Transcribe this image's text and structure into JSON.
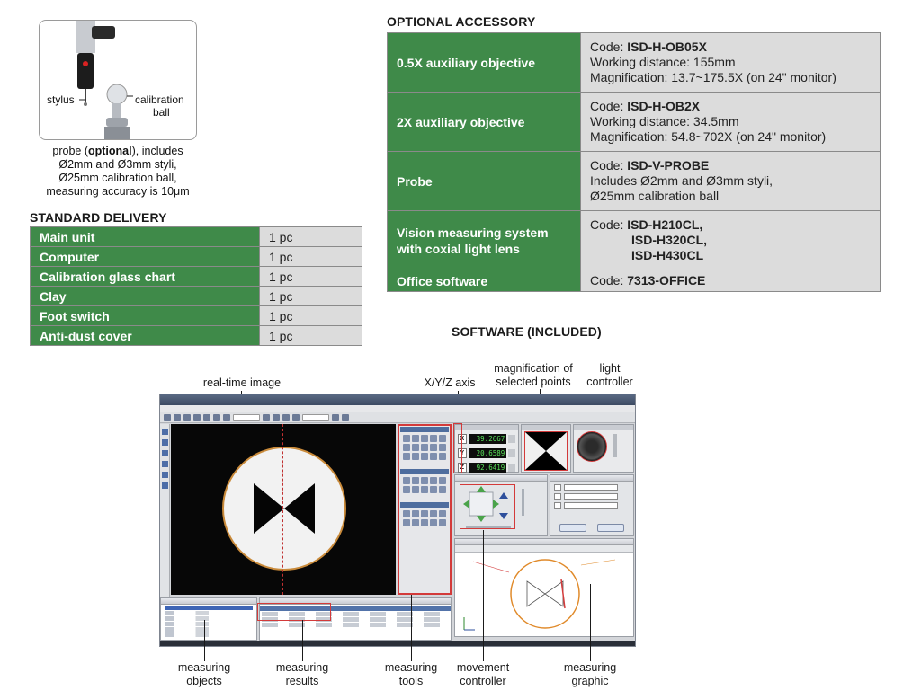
{
  "probe": {
    "stylus_label": "stylus",
    "calibration_label_1": "calibration",
    "calibration_label_2": "ball",
    "caption_1_a": "probe (",
    "caption_1_b": "optional",
    "caption_1_c": "), includes",
    "caption_2": "Ø2mm and Ø3mm styli,",
    "caption_3": "Ø25mm calibration ball,",
    "caption_4": "measuring accuracy is 10μm"
  },
  "standard_delivery": {
    "heading": "STANDARD DELIVERY",
    "rows": [
      {
        "item": "Main unit",
        "qty": "1 pc"
      },
      {
        "item": "Computer",
        "qty": "1 pc"
      },
      {
        "item": "Calibration glass chart",
        "qty": "1 pc"
      },
      {
        "item": "Clay",
        "qty": "1 pc"
      },
      {
        "item": "Foot switch",
        "qty": "1 pc"
      },
      {
        "item": "Anti-dust cover",
        "qty": "1 pc"
      }
    ]
  },
  "optional_accessory": {
    "heading": "OPTIONAL ACCESSORY",
    "rows": [
      {
        "name": "0.5X auxiliary objective",
        "code_label": "Code: ",
        "code": "ISD-H-OB05X",
        "line_2": "Working distance: 155mm",
        "line_3": "Magnification: 13.7~175.5X (on 24\" monitor)"
      },
      {
        "name": "2X auxiliary objective",
        "code_label": "Code: ",
        "code": "ISD-H-OB2X",
        "line_2": "Working distance: 34.5mm",
        "line_3": "Magnification: 54.8~702X (on 24\" monitor)"
      },
      {
        "name": "Probe",
        "code_label": "Code: ",
        "code": "ISD-V-PROBE",
        "line_2": "Includes Ø2mm and Ø3mm styli,",
        "line_3": "Ø25mm calibration ball"
      },
      {
        "name_1": "Vision measuring system",
        "name_2": "with coxial light lens",
        "code_label": "Code: ",
        "code": "ISD-H210CL,",
        "code_2": "ISD-H320CL,",
        "code_3": "ISD-H430CL"
      },
      {
        "name": "Office software",
        "code_label": "Code: ",
        "code": "7313-OFFICE"
      }
    ]
  },
  "software": {
    "heading": "SOFTWARE (INCLUDED)",
    "xyz": {
      "x_axis": "X",
      "y_axis": "Y",
      "z_axis": "Z",
      "x": "39.2667",
      "y": "20.6589",
      "z": "92.6419"
    },
    "callouts": {
      "realtime_image": "real-time image",
      "xyz_axis": "X/Y/Z axis",
      "magnification_1": "magnification of",
      "magnification_2": "selected points",
      "light_1": "light",
      "light_2": "controller",
      "objects_1": "measuring",
      "objects_2": "objects",
      "results_1": "measuring",
      "results_2": "results",
      "tools_1": "measuring",
      "tools_2": "tools",
      "movement_1": "movement",
      "movement_2": "controller",
      "graphic_1": "measuring",
      "graphic_2": "graphic"
    }
  }
}
